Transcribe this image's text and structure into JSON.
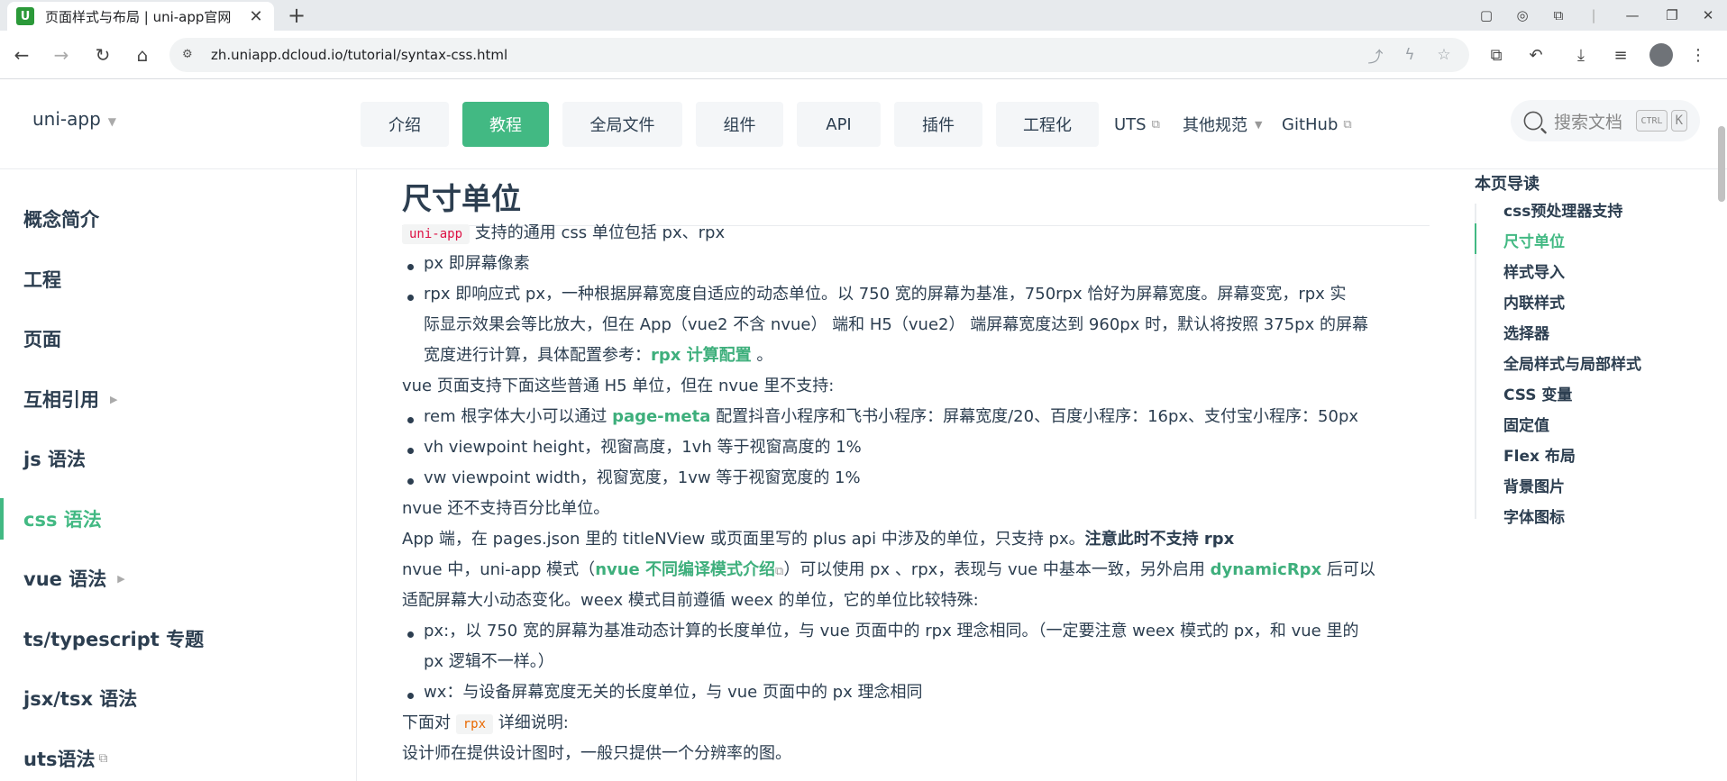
{
  "browser": {
    "tab_title": "页面样式与布局 | uni-app官网",
    "favicon_letter": "U",
    "url": "zh.uniapp.dcloud.io/tutorial/syntax-css.html"
  },
  "header": {
    "brand": "uni-app",
    "nav": [
      {
        "label": "介绍",
        "active": false
      },
      {
        "label": "教程",
        "active": true
      },
      {
        "label": "全局文件",
        "active": false
      },
      {
        "label": "组件",
        "active": false
      },
      {
        "label": "API",
        "active": false
      },
      {
        "label": "插件",
        "active": false
      },
      {
        "label": "工程化",
        "active": false
      }
    ],
    "links": {
      "uts": "UTS",
      "other": "其他规范",
      "github": "GitHub"
    },
    "search": {
      "placeholder": "搜索文档",
      "key1": "CTRL",
      "key2": "K"
    }
  },
  "sidebar": {
    "items": [
      {
        "label": "概念简介"
      },
      {
        "label": "工程"
      },
      {
        "label": "页面"
      },
      {
        "label": "互相引用"
      },
      {
        "label": "js 语法"
      },
      {
        "label": "css 语法",
        "active": true
      },
      {
        "label": "vue 语法"
      },
      {
        "label": "ts/typescript 专题"
      },
      {
        "label": "jsx/tsx 语法"
      },
      {
        "label": "uts语法"
      }
    ]
  },
  "content": {
    "heading": "尺寸单位",
    "p1_code": "uni-app",
    "p1_text": " 支持的通用 css 单位包括 px、rpx",
    "li1": "px 即屏幕像素",
    "li2_l1": "rpx 即响应式 px，一种根据屏幕宽度自适应的动态单位。以 750 宽的屏幕为基准，750rpx 恰好为屏幕宽度。屏幕变宽，rpx 实",
    "li2_l2": "际显示效果会等比放大，但在 App（vue2 不含 nvue） 端和 H5（vue2） 端屏幕宽度达到 960px 时，默认将按照 375px 的屏幕",
    "li2_l3_pre": "宽度进行计算，具体配置参考：",
    "li2_l3_link": "rpx 计算配置",
    "li2_l3_post": " 。",
    "p2": "vue 页面支持下面这些普通 H5 单位，但在 nvue 里不支持:",
    "li3_pre": "rem 根字体大小可以通过 ",
    "li3_link": "page-meta",
    "li3_post": " 配置抖音小程序和飞书小程序：屏幕宽度/20、百度小程序：16px、支付宝小程序：50px",
    "li4": "vh viewpoint height，视窗高度，1vh 等于视窗高度的 1%",
    "li5": "vw viewpoint width，视窗宽度，1vw 等于视窗宽度的 1%",
    "p3": "nvue 还不支持百分比单位。",
    "p4_pre": "App 端，在 pages.json 里的 titleNView 或页面里写的 plus api 中涉及的单位，只支持 px。",
    "p4_strong": "注意此时不支持 rpx",
    "p5_pre": "nvue 中，uni-app 模式（",
    "p5_link": "nvue 不同编译模式介绍",
    "p5_mid": "）可以使用 px 、rpx，表现与 vue 中基本一致，另外启用 ",
    "p5_link2": "dynamicRpx",
    "p5_post": " 后可以",
    "p5_l2": "适配屏幕大小动态变化。weex 模式目前遵循 weex 的单位，它的单位比较特殊:",
    "li6_l1": "px:，以 750 宽的屏幕为基准动态计算的长度单位，与 vue 页面中的 rpx 理念相同。（一定要注意 weex 模式的 px，和 vue 里的",
    "li6_l2": "px 逻辑不一样。）",
    "li7": "wx：与设备屏幕宽度无关的长度单位，与 vue 页面中的 px 理念相同",
    "p6_pre": "下面对 ",
    "p6_code": "rpx",
    "p6_post": " 详细说明:",
    "p7": "设计师在提供设计图时，一般只提供一个分辨率的图。"
  },
  "toc": {
    "heading": "本页导读",
    "items": [
      {
        "label": "css预处理器支持"
      },
      {
        "label": "尺寸单位",
        "active": true
      },
      {
        "label": "样式导入"
      },
      {
        "label": "内联样式"
      },
      {
        "label": "选择器"
      },
      {
        "label": "全局样式与局部样式"
      },
      {
        "label": "CSS 变量"
      },
      {
        "label": "固定值"
      },
      {
        "label": "Flex 布局"
      },
      {
        "label": "背景图片"
      },
      {
        "label": "字体图标"
      }
    ]
  },
  "colors": {
    "accent": "#42b983",
    "link": "#3eaf7c",
    "text": "#2c3e50"
  }
}
